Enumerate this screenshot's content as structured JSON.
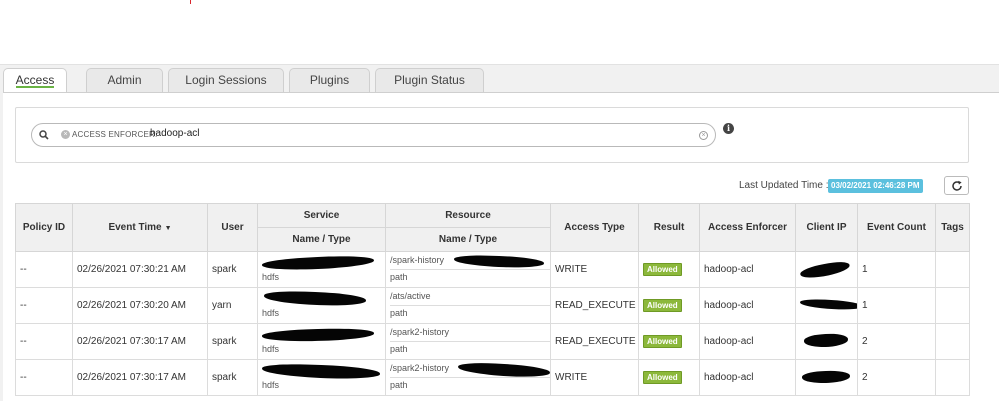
{
  "tabs": [
    {
      "label": "Access",
      "active": true
    },
    {
      "label": "Admin",
      "active": false
    },
    {
      "label": "Login Sessions",
      "active": false
    },
    {
      "label": "Plugins",
      "active": false
    },
    {
      "label": "Plugin Status",
      "active": false
    }
  ],
  "search": {
    "facet_label": "ACCESS ENFORCER:",
    "facet_value": "hadoop-acl",
    "facet_remove_glyph": "×",
    "clear_glyph": "×",
    "info_glyph": "i"
  },
  "status": {
    "last_updated_label": "Last Updated Time :",
    "last_updated_value": "03/02/2021 02:46:28 PM"
  },
  "table": {
    "group_headers": {
      "service": "Service",
      "resource": "Resource"
    },
    "headers": {
      "policy_id": "Policy ID",
      "event_time": "Event Time",
      "user": "User",
      "service_name_type": "Name / Type",
      "resource_name_type": "Name / Type",
      "access_type": "Access Type",
      "result": "Result",
      "access_enforcer": "Access Enforcer",
      "client_ip": "Client IP",
      "event_count": "Event Count",
      "tags": "Tags"
    },
    "sort_glyph": "▼",
    "rows": [
      {
        "policy_id": "--",
        "event_time": "02/26/2021 07:30:21 AM",
        "user": "spark",
        "service_type": "hdfs",
        "resource_name": "/spark-history",
        "resource_type": "path",
        "access_type": "WRITE",
        "result": "Allowed",
        "access_enforcer": "hadoop-acl",
        "event_count": "1"
      },
      {
        "policy_id": "--",
        "event_time": "02/26/2021 07:30:20 AM",
        "user": "yarn",
        "service_type": "hdfs",
        "resource_name": "/ats/active",
        "resource_type": "path",
        "access_type": "READ_EXECUTE",
        "result": "Allowed",
        "access_enforcer": "hadoop-acl",
        "event_count": "1"
      },
      {
        "policy_id": "--",
        "event_time": "02/26/2021 07:30:17 AM",
        "user": "spark",
        "service_type": "hdfs",
        "resource_name": "/spark2-history",
        "resource_type": "path",
        "access_type": "READ_EXECUTE",
        "result": "Allowed",
        "access_enforcer": "hadoop-acl",
        "event_count": "2"
      },
      {
        "policy_id": "--",
        "event_time": "02/26/2021 07:30:17 AM",
        "user": "spark",
        "service_type": "hdfs",
        "resource_name": "/spark2-history",
        "resource_type": "path",
        "access_type": "WRITE",
        "result": "Allowed",
        "access_enforcer": "hadoop-acl",
        "event_count": "2"
      }
    ]
  },
  "colors": {
    "active_tab_underline": "#6ab344",
    "allowed_badge": "#8cb83b",
    "time_badge": "#5bc0de"
  }
}
